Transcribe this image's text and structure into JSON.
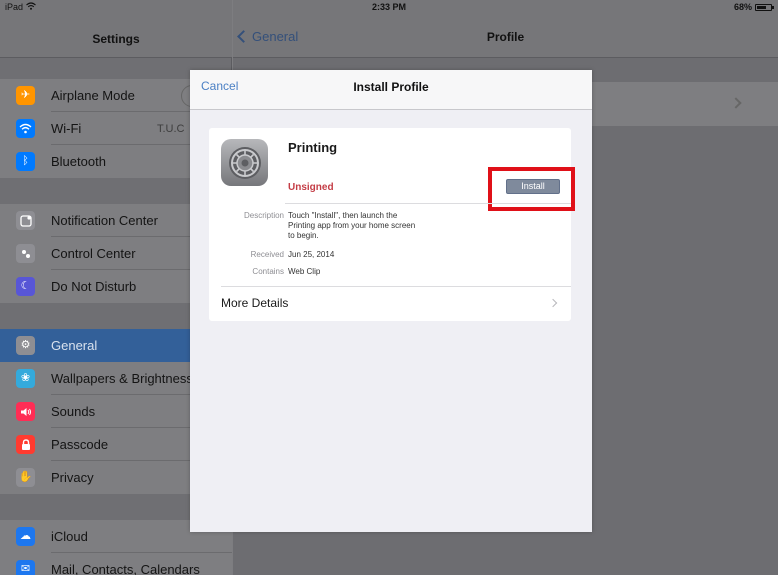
{
  "status_bar": {
    "device": "iPad",
    "wifi_icon": "wifi-icon",
    "time": "2:33 PM",
    "battery": "68%"
  },
  "settings_pane": {
    "title": "Settings",
    "groups": [
      {
        "items": [
          {
            "label": "Airplane Mode",
            "icon": "airplane-icon",
            "color": "#ff9500"
          },
          {
            "label": "Wi-Fi",
            "value": "T.U.C",
            "icon": "wifi-icon",
            "color": "#007aff"
          },
          {
            "label": "Bluetooth",
            "icon": "bluetooth-icon",
            "color": "#007aff"
          }
        ]
      },
      {
        "items": [
          {
            "label": "Notification Center",
            "icon": "notification-icon",
            "color": "#8e8e93"
          },
          {
            "label": "Control Center",
            "icon": "control-center-icon",
            "color": "#8e8e93"
          },
          {
            "label": "Do Not Disturb",
            "icon": "moon-icon",
            "color": "#5856d6"
          }
        ]
      },
      {
        "items": [
          {
            "label": "General",
            "icon": "gear-icon",
            "color": "#8e8e93",
            "selected": true
          },
          {
            "label": "Wallpapers & Brightness",
            "icon": "flower-icon",
            "color": "#34aadc"
          },
          {
            "label": "Sounds",
            "icon": "speaker-icon",
            "color": "#ff2d55"
          },
          {
            "label": "Passcode",
            "icon": "lock-icon",
            "color": "#ff3b30"
          },
          {
            "label": "Privacy",
            "icon": "hand-icon",
            "color": "#8e8e93"
          }
        ]
      },
      {
        "items": [
          {
            "label": "iCloud",
            "icon": "cloud-icon",
            "color": "#1d77ef"
          },
          {
            "label": "Mail, Contacts, Calendars",
            "icon": "mail-icon",
            "color": "#1d77ef"
          }
        ]
      }
    ]
  },
  "detail_pane": {
    "back_label": "General",
    "title": "Profile"
  },
  "install_dialog": {
    "cancel_label": "Cancel",
    "title": "Install Profile",
    "profile": {
      "name": "Printing",
      "status": "Unsigned",
      "install_label": "Install",
      "description_key": "Description",
      "description_value": "Touch \"Install\", then launch the Printing app from your home screen to begin.",
      "received_key": "Received",
      "received_value": "Jun 25, 2014",
      "contains_key": "Contains",
      "contains_value": "Web Clip"
    },
    "more_details_label": "More Details",
    "highlight_color": "#e01018"
  }
}
